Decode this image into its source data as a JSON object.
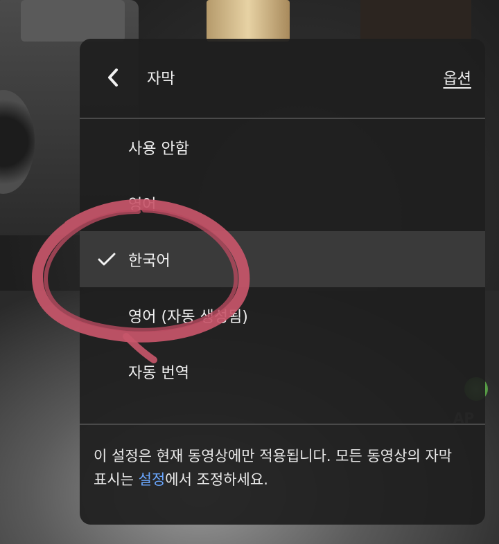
{
  "header": {
    "title": "자막",
    "options_label": "옵션"
  },
  "subtitle_options": [
    {
      "label": "사용 안함",
      "selected": false
    },
    {
      "label": "영어",
      "selected": false
    },
    {
      "label": "한국어",
      "selected": true
    },
    {
      "label": "영어 (자동 생성됨)",
      "selected": false
    },
    {
      "label": "자동 번역",
      "selected": false
    }
  ],
  "footer": {
    "text_before": "이 설정은 현재 동영상에만 적용됩니다. 모든 동영상의 자막 표시는 ",
    "link": "설정",
    "text_after": "에서 조정하세요."
  },
  "background": {
    "overlay_text": "AP"
  },
  "colors": {
    "panel": "#1e1e1e",
    "selected_row": "#3a3a3a",
    "link": "#6aa7ff",
    "annotation": "#c8566a"
  }
}
